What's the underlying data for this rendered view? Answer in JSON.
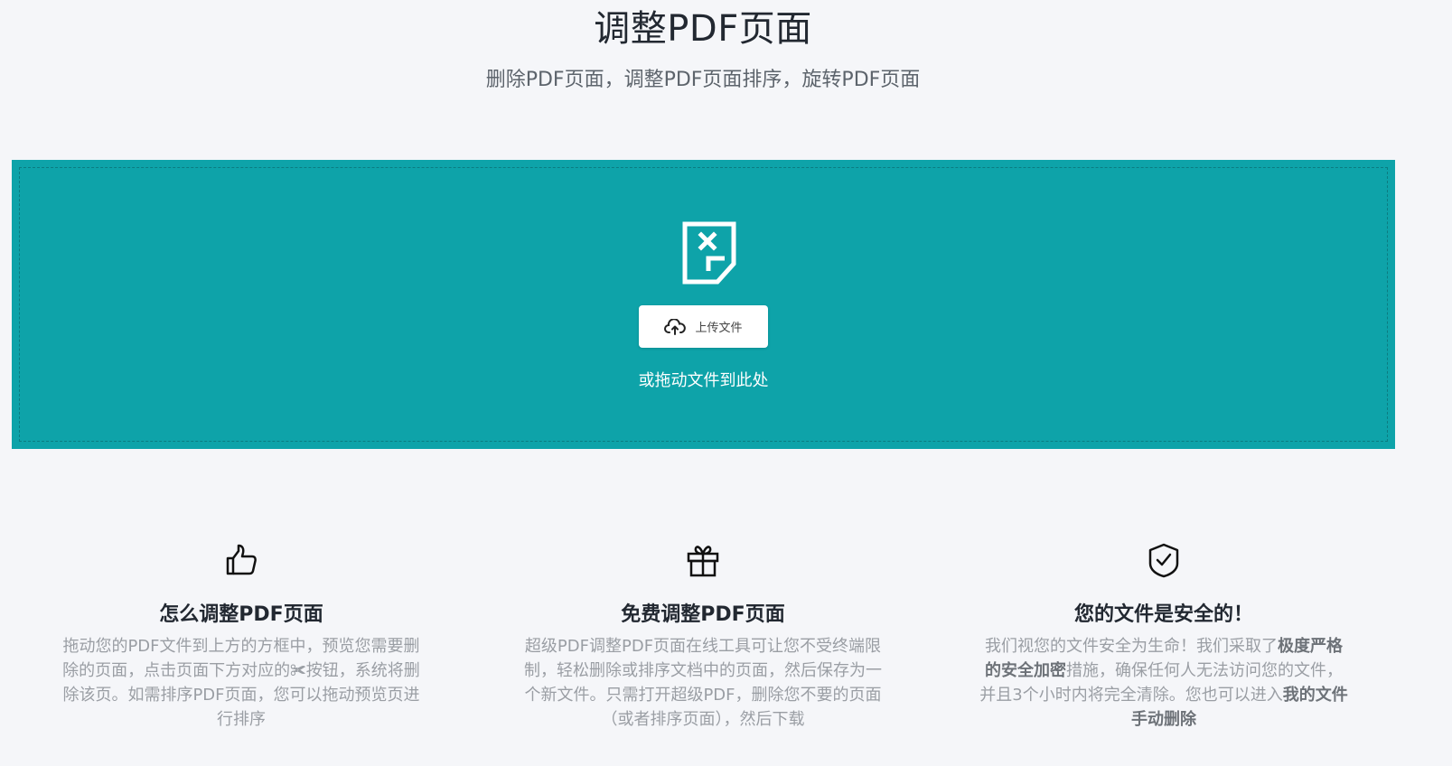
{
  "header": {
    "title": "调整PDF页面",
    "subtitle": "删除PDF页面，调整PDF页面排序，旋转PDF页面"
  },
  "dropzone": {
    "icon": "pdf-remove-icon",
    "upload_label": "上传文件",
    "upload_icon": "cloud-upload-icon",
    "hint": "或拖动文件到此处",
    "background_color": "#0ea3a9"
  },
  "features": [
    {
      "icon": "thumbs-up-icon",
      "title": "怎么调整PDF页面",
      "text": "拖动您的PDF文件到上方的方框中，预览您需要删除的页面，点击页面下方对应的✀按钮，系统将删除该页。如需排序PDF页面，您可以拖动预览页进行排序"
    },
    {
      "icon": "gift-icon",
      "title": "免费调整PDF页面",
      "text": "超级PDF调整PDF页面在线工具可让您不受终端限制，轻松删除或排序文档中的页面，然后保存为一个新文件。只需打开超级PDF，删除您不要的页面（或者排序页面），然后下载"
    },
    {
      "icon": "shield-check-icon",
      "title": "您的文件是安全的！",
      "text_before": "我们视您的文件安全为生命！我们采取了",
      "text_bold_1": "极度严格的安全加密",
      "text_middle": "措施，确保任何人无法访问您的文件，并且3个小时内将完全清除。您也可以进入",
      "text_bold_2": "我的文件手动删除"
    }
  ]
}
